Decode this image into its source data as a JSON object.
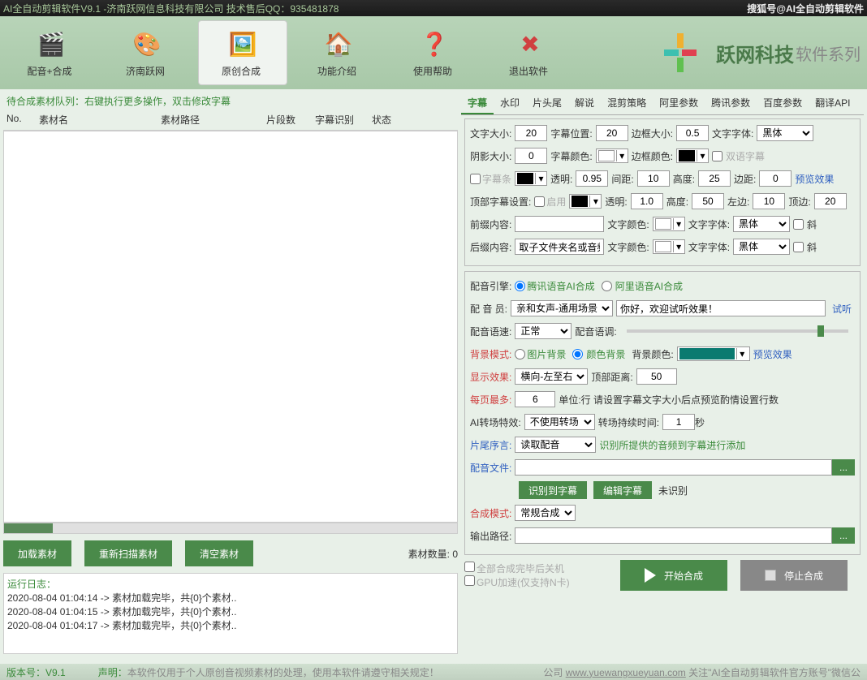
{
  "title_left": "AI全自动剪辑软件V9.1 -济南跃网信息科技有限公司 技术售后QQ：935481878",
  "title_right": "搜狐号@AI全自动剪辑软件",
  "toolbar": [
    {
      "label": "配音+合成"
    },
    {
      "label": "济南跃网"
    },
    {
      "label": "原创合成"
    },
    {
      "label": "功能介绍"
    },
    {
      "label": "使用帮助"
    },
    {
      "label": "退出软件"
    }
  ],
  "logo": "跃网科技",
  "logo_sub": "软件系列",
  "queue_hint": "待合成素材队列：右键执行更多操作，双击修改字幕",
  "cols": {
    "no": "No.",
    "name": "素材名",
    "path": "素材路径",
    "seg": "片段数",
    "rec": "字幕识别",
    "stat": "状态"
  },
  "btns": {
    "load": "加载素材",
    "rescan": "重新扫描素材",
    "clear": "清空素材"
  },
  "mat_count_lbl": "素材数量:",
  "mat_count": "0",
  "log_title": "运行日志：",
  "logs": [
    "2020-08-04 01:04:14 -> 素材加载完毕，共{0}个素材..",
    "2020-08-04 01:04:15 -> 素材加载完毕，共{0}个素材..",
    "2020-08-04 01:04:17 -> 素材加载完毕，共{0}个素材.."
  ],
  "tabs": [
    "字幕",
    "水印",
    "片头尾",
    "解说",
    "混剪策略",
    "阿里参数",
    "腾讯参数",
    "百度参数",
    "翻译API"
  ],
  "f": {
    "font_size_l": "文字大小:",
    "font_size": "20",
    "pos_l": "字幕位置:",
    "pos": "20",
    "border_l": "边框大小:",
    "border": "0.5",
    "font_l": "文字字体:",
    "font": "黑体",
    "shadow_l": "阴影大小:",
    "shadow": "0",
    "color_l": "字幕颜色:",
    "bcolor_l": "边框颜色:",
    "bilingual": "双语字幕",
    "bar_l": "字幕条",
    "trans_l": "透明:",
    "trans": "0.95",
    "gap_l": "间距:",
    "gap": "10",
    "h_l": "高度:",
    "h": "25",
    "m_l": "边距:",
    "m": "0",
    "preview": "预览效果",
    "top_set_l": "顶部字幕设置:",
    "enable": "启用",
    "trans2": "1.0",
    "h2": "50",
    "left_l": "左边:",
    "left": "10",
    "top_l": "顶边:",
    "top": "20",
    "prefix_l": "前缀内容:",
    "prefix": "",
    "tcolor_l": "文字颜色:",
    "tfont": "黑体",
    "italic": "斜",
    "suffix_l": "后缀内容:",
    "suffix": "取子文件夹名或音频"
  },
  "v": {
    "engine_l": "配音引擎:",
    "opt1": "腾讯语音AI合成",
    "opt2": "阿里语音AI合成",
    "voice_l": "配 音 员:",
    "voice": "亲和女声-通用场景",
    "test_text": "你好，欢迎试听效果！",
    "test": "试听",
    "speed_l": "配音语速:",
    "speed": "正常",
    "tone_l": "配音语调:",
    "bgmode_l": "背景模式:",
    "bgopt1": "图片背景",
    "bgopt2": "颜色背景",
    "bgcolor_l": "背景颜色:",
    "effect_l": "显示效果:",
    "effect": "横向-左至右",
    "topdist_l": "顶部距离:",
    "topdist": "50",
    "maxline_l": "每页最多:",
    "maxline": "6",
    "maxline_hint": "单位:行 请设置字幕文字大小后点预览酌情设置行数",
    "trans_l": "AI转场特效:",
    "trans": "不使用转场",
    "dur_l": "转场持续时间:",
    "dur": "1",
    "dur_unit": "秒",
    "tail_l": "片尾序言:",
    "tail": "读取配音",
    "tail_hint": "识别所提供的音频到字幕进行添加",
    "file_l": "配音文件:",
    "rec_btn": "识别到字幕",
    "edit_btn": "编辑字幕",
    "unrec": "未识别",
    "mode_l": "合成模式:",
    "mode": "常规合成",
    "out_l": "输出路径:",
    "shutdown": "全部合成完毕后关机",
    "gpu": "GPU加速(仅支持N卡)",
    "start": "开始合成",
    "stop": "停止合成"
  },
  "footer": {
    "ver_l": "版本号：",
    "ver": "V9.1",
    "decl_l": "声明：",
    "decl": "本软件仅用于个人原创音视频素材的处理，使用本软件请遵守相关规定！",
    "site_pre": "公司",
    "site": "www.yuewangxueyuan.com",
    "site_post": " 关注\"AI全自动剪辑软件官方账号\"微信公"
  }
}
